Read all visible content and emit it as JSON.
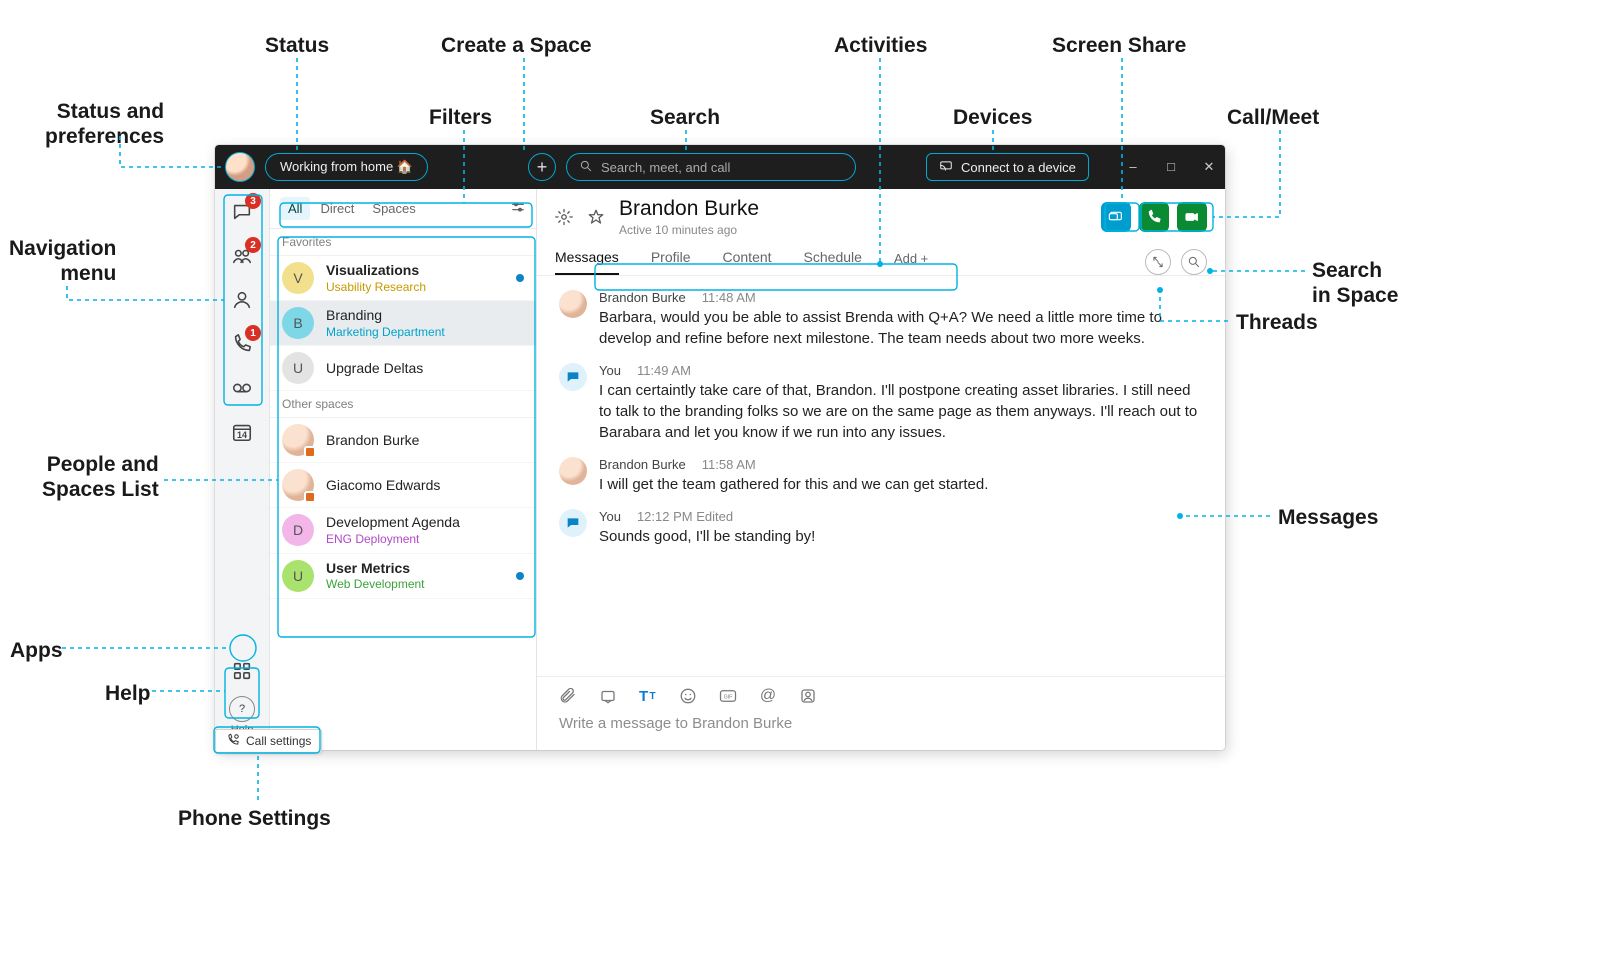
{
  "callouts": {
    "status": "Status",
    "create_space": "Create a Space",
    "activities": "Activities",
    "screen_share": "Screen Share",
    "status_prefs1": "Status and",
    "status_prefs2": "preferences",
    "filters": "Filters",
    "search": "Search",
    "devices": "Devices",
    "call_meet": "Call/Meet",
    "nav_menu1": "Navigation",
    "nav_menu2": "menu",
    "search_space1": "Search",
    "search_space2": "in Space",
    "threads": "Threads",
    "people_list1": "People and",
    "people_list2": "Spaces List",
    "messages": "Messages",
    "apps": "Apps",
    "help": "Help",
    "phone_settings": "Phone Settings"
  },
  "header": {
    "status": "Working from home 🏠",
    "search_placeholder": "Search, meet, and call",
    "device_btn": "Connect to a device"
  },
  "rail": {
    "badges": {
      "chat": "3",
      "teams": "2",
      "calls": "1"
    },
    "calendar_num": "14",
    "help": "Help"
  },
  "callsettings": "Call settings",
  "filters": {
    "all": "All",
    "direct": "Direct",
    "spaces": "Spaces"
  },
  "sections": {
    "favorites": "Favorites",
    "other": "Other spaces"
  },
  "spaces": {
    "favorites": [
      {
        "title": "Visualizations",
        "sub": "Usability Research",
        "subColor": "#c79a00",
        "avatar": "V",
        "avatarBg": "#f2e08c",
        "bold": true,
        "dot": true,
        "selected": false
      },
      {
        "title": "Branding",
        "sub": "Marketing Department",
        "subColor": "#00a3c9",
        "avatar": "B",
        "avatarBg": "#7ed7e6",
        "bold": false,
        "dot": false,
        "selected": true
      },
      {
        "title": "Upgrade Deltas",
        "sub": "",
        "subColor": "",
        "avatar": "U",
        "avatarBg": "#e3e3e3",
        "bold": false,
        "dot": false,
        "selected": false
      }
    ],
    "other": [
      {
        "title": "Brandon Burke",
        "sub": "",
        "subColor": "",
        "avatar": "face",
        "avatarBg": "face",
        "bold": false,
        "dot": false,
        "status": "#e06a1b"
      },
      {
        "title": "Giacomo Edwards",
        "sub": "",
        "subColor": "",
        "avatar": "face",
        "avatarBg": "face",
        "bold": false,
        "dot": false,
        "status": "#e06a1b"
      },
      {
        "title": "Development Agenda",
        "sub": "ENG Deployment",
        "subColor": "#b348c9",
        "avatar": "D",
        "avatarBg": "#f2b6e8",
        "bold": false,
        "dot": false
      },
      {
        "title": "User Metrics",
        "sub": "Web Development",
        "subColor": "#3aa23a",
        "avatar": "U",
        "avatarBg": "#a9e26d",
        "bold": true,
        "dot": true
      }
    ]
  },
  "conversation": {
    "title": "Brandon Burke",
    "subtitle": "Active 10 minutes ago",
    "tabs": [
      "Messages",
      "Profile",
      "Content",
      "Schedule"
    ],
    "add": "Add  +",
    "composer_placeholder": "Write a message to Brandon Burke"
  },
  "messages": [
    {
      "who": "Brandon Burke",
      "time": "11:48 AM",
      "mine": false,
      "text": "Barbara, would you be able to assist Brenda with Q+A? We need a little more time to develop and refine before next milestone. The team needs about two more weeks."
    },
    {
      "who": "You",
      "time": "11:49 AM",
      "mine": true,
      "text": "I can certaintly take care of that, Brandon. I'll postpone creating asset libraries. I still need to talk to the branding folks so we are on the same page as them anyways. I'll reach out to Barabara and let you know if we run into any issues."
    },
    {
      "who": "Brandon Burke",
      "time": "11:58 AM",
      "mine": false,
      "text": "I will get the team gathered for this and we can get started."
    },
    {
      "who": "You",
      "time": "12:12 PM Edited",
      "mine": true,
      "text": "Sounds good, I'll be standing by!"
    }
  ]
}
